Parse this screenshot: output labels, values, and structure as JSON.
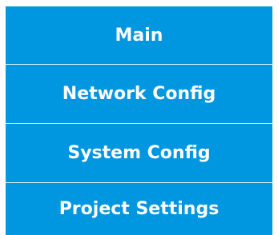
{
  "menu": {
    "items": [
      {
        "label": "Main"
      },
      {
        "label": "Network Config"
      },
      {
        "label": "System Config"
      },
      {
        "label": "Project Settings"
      }
    ]
  },
  "colors": {
    "menu_background": "#0096e0",
    "menu_text": "#ffffff",
    "divider": "#d9eef9"
  }
}
